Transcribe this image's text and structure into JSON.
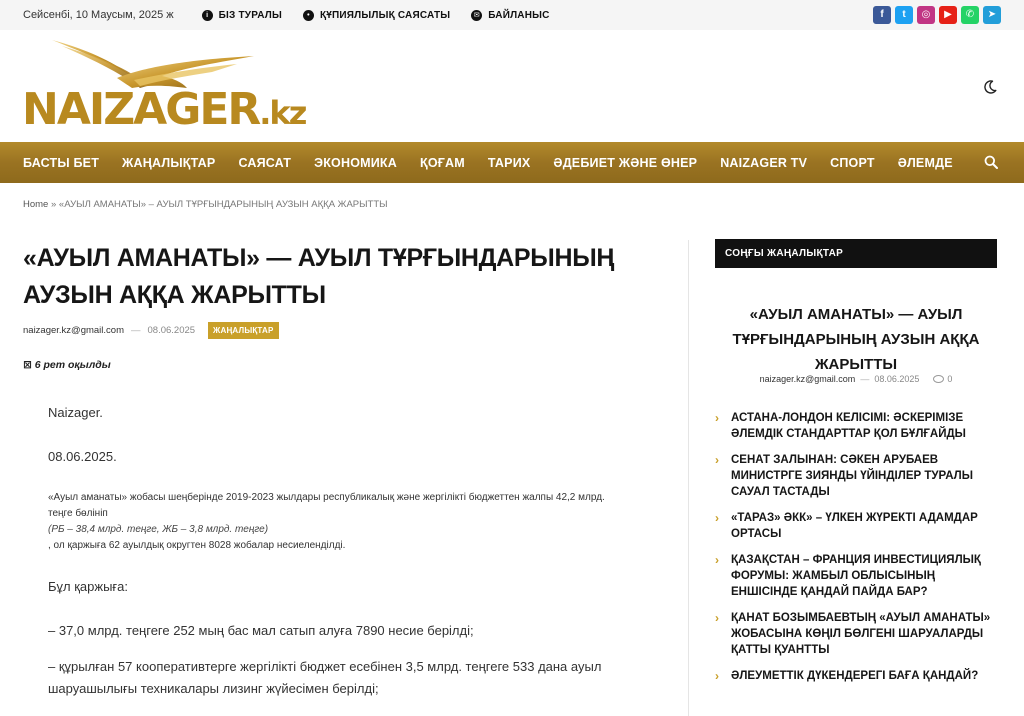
{
  "topbar": {
    "date": "Сейсенбі, 10 Маусым, 2025 ж",
    "links": [
      {
        "label": "БІЗ ТУРАЛЫ",
        "icon": "info-icon"
      },
      {
        "label": "ҚҰПИЯЛЫЛЫҚ САЯСАТЫ",
        "icon": "shield-icon"
      },
      {
        "label": "БАЙЛАНЫС",
        "icon": "mail-icon"
      }
    ],
    "socials": [
      {
        "name": "facebook-icon",
        "glyph": "f",
        "color": "#3b5998"
      },
      {
        "name": "twitter-icon",
        "glyph": "t",
        "color": "#1da1f2"
      },
      {
        "name": "instagram-icon",
        "glyph": "◎",
        "color": "#c13584"
      },
      {
        "name": "youtube-icon",
        "glyph": "▶",
        "color": "#e62117"
      },
      {
        "name": "whatsapp-icon",
        "glyph": "✆",
        "color": "#25d366"
      },
      {
        "name": "telegram-icon",
        "glyph": "➤",
        "color": "#229ed9"
      }
    ]
  },
  "header": {
    "logo_text": "NAIZAGER",
    "logo_suffix": ".kz",
    "logo_color": "#b8891f"
  },
  "nav": {
    "items": [
      "БАСТЫ БЕТ",
      "ЖАҢАЛЫҚТАР",
      "САЯСАТ",
      "ЭКОНОМИКА",
      "ҚОҒАМ",
      "ТАРИХ",
      "ӘДЕБИЕТ ЖӘНЕ ӨНЕР",
      "NAIZAGER TV",
      "СПОРТ",
      "ӘЛЕМДЕ"
    ],
    "accent": "#9a7322"
  },
  "breadcrumb": {
    "home": "Home",
    "separator": "»",
    "current": "«АУЫЛ АМАНАТЫ» – АУЫЛ ТҰРҒЫНДАРЫНЫҢ АУЗЫН АҚҚА ЖАРЫТТЫ"
  },
  "article": {
    "title": "«АУЫЛ АМАНАТЫ» — АУЫЛ ТҰРҒЫНДАРЫНЫҢ АУЗЫН АҚҚА ЖАРЫТТЫ",
    "author": "naizager.kz@gmail.com",
    "date": "08.06.2025",
    "category": "ЖАҢАЛЫҚТАР",
    "category_color": "#c9a02a",
    "reads": "6 рет оқылды",
    "paragraphs": {
      "p1": "Naizager.",
      "p2": "08.06.2025.",
      "p3": "«Ауыл аманаты» жобасы шеңберінде 2019-2023 жылдары республикалық және жергілікті бюджеттен жалпы 42,2 млрд. теңге бөлініп",
      "p4": "(РБ – 38,4 млрд. теңге, ЖБ – 3,8 млрд. теңге)",
      "p5": ", ол қаржыға 62 ауылдық округтен 8028 жобалар несиеленділді.",
      "p6": "Бұл қаржыға:",
      "p7": "– 37,0 млрд. теңгеге 252 мың бас мал сатып алуға 7890 несие берілді;",
      "p8": "– құрылған 57 кооперативтерге жергілікті бюджет есебінен 3,5 млрд. теңгеге 533 дана ауыл шаруашылығы техникалары лизинг жүйесімен берілді;"
    }
  },
  "sidebar": {
    "heading": "СОҢҒЫ ЖАҢАЛЫҚТАР",
    "featured": {
      "title": "«АУЫЛ АМАНАТЫ» — АУЫЛ ТҰРҒЫНДАРЫНЫҢ АУЗЫН АҚҚА ЖАРЫТТЫ",
      "author": "naizager.kz@gmail.com",
      "date": "08.06.2025",
      "comments": "0"
    },
    "items": [
      "АСТАНА-ЛОНДОН КЕЛІСІМІ: ӘСКЕРІМІЗЕ ӘЛЕМДІК СТАНДАРТТАР ҚОЛ БҰЛҒАЙДЫ",
      "СЕНАТ ЗАЛЫНАН: СӘКЕН АРУБАЕВ МИНИСТРГЕ ЗИЯНДЫ ҮЙІНДІЛЕР ТУРАЛЫ САУАЛ ТАСТАДЫ",
      "«ТАРАЗ» ӘКК» – ҮЛКЕН ЖҮРЕКТІ АДАМДАР ОРТАСЫ",
      "ҚАЗАҚСТАН – ФРАНЦИЯ ИНВЕСТИЦИЯЛЫҚ ФОРУМЫ: ЖАМБЫЛ ОБЛЫСЫНЫҢ ЕНШІСІНДЕ ҚАНДАЙ ПАЙДА БАР?",
      "ҚАНАТ БОЗЫМБАЕВТЫҢ «АУЫЛ АМАНАТЫ» ЖОБАСЫНА КӨҢІЛ БӨЛГЕНІ ШАРУАЛАРДЫ ҚАТТЫ ҚУАНТТЫ",
      "ӘЛЕУМЕТТІК ДҮКЕНДЕРЕГІ БАҒА ҚАНДАЙ?"
    ]
  }
}
